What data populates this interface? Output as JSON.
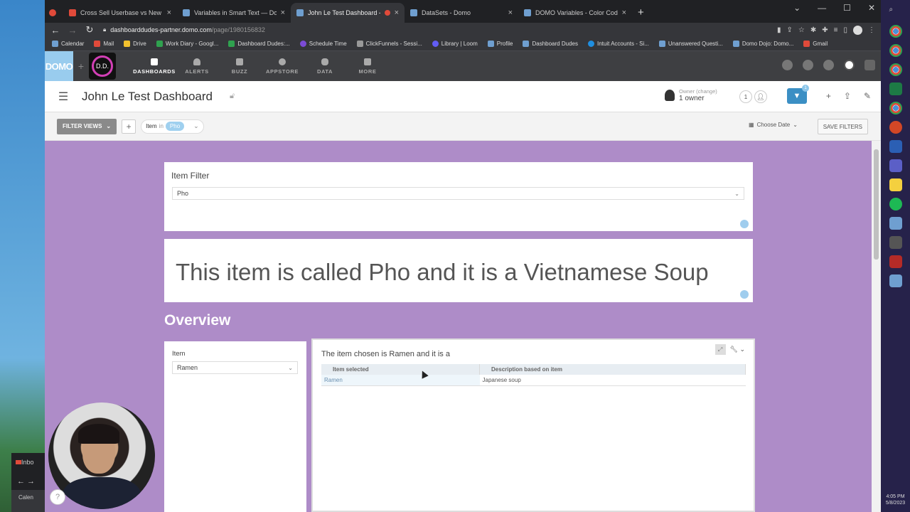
{
  "browser": {
    "tabs": [
      {
        "label": "Cross Sell Userbase vs New Logo",
        "active": false
      },
      {
        "label": "Variables in Smart Text — Domo",
        "active": false
      },
      {
        "label": "John Le Test Dashboard - Do",
        "active": true
      },
      {
        "label": "DataSets - Domo",
        "active": false
      },
      {
        "label": "DOMO Variables - Color Coding",
        "active": false
      }
    ],
    "url_host": "dashboarddudes-partner.domo.com",
    "url_path": "/page/1980156832",
    "bookmarks": [
      "Calendar",
      "Mail",
      "Drive",
      "Work Diary - Googl...",
      "Dashboard Dudes:...",
      "Schedule Time",
      "ClickFunnels - Sessi...",
      "Library | Loom",
      "Profile",
      "Dashboard Dudes",
      "Intuit Accounts - Si...",
      "Unanswered Questi...",
      "Domo Dojo: Domo...",
      "Gmail"
    ]
  },
  "domo": {
    "logo": "DOMO",
    "brand_initials": "D.D.",
    "nav": [
      "DASHBOARDS",
      "ALERTS",
      "BUZZ",
      "APPSTORE",
      "DATA",
      "MORE"
    ]
  },
  "page": {
    "title": "John Le Test Dashboard",
    "owner_label": "Owner (change)",
    "owner_value": "1 owner",
    "share_count": "1",
    "filter_badge": "1"
  },
  "filters": {
    "views_label": "FILTER VIEWS",
    "pill_field": "Item",
    "pill_op": "in",
    "pill_value": "Pho",
    "date_label": "Choose Date",
    "save_label": "SAVE FILTERS"
  },
  "cards": {
    "item_filter_title": "Item Filter",
    "item_filter_value": "Pho",
    "smart_text": "This item is called Pho and it is a Vietnamese Soup",
    "section_title": "Overview",
    "item_title": "Item",
    "item_value": "Ramen",
    "table_card_title": "The item chosen is Ramen and it is a",
    "table_headers": [
      "Item selected",
      "Description based on item"
    ],
    "table_rows": [
      [
        "Ramen",
        "Japanese soup"
      ]
    ]
  },
  "ghost_window": {
    "tab": "Inbo",
    "bookmark": "Calen"
  },
  "taskbar": {
    "time": "4:05 PM",
    "date": "5/8/2023"
  },
  "colors": {
    "canvas": "#ae8cc8",
    "accent": "#3b8fc4"
  }
}
